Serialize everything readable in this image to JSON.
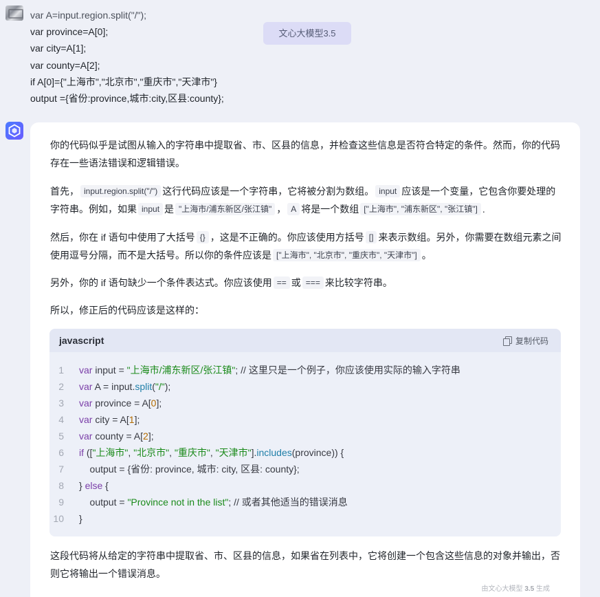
{
  "user": {
    "lines": [
      "var A=input.region.split(\"/\");",
      "var province=A[0];",
      "var city=A[1];",
      "var county=A[2];",
      "if A[0]={\"上海市\",\"北京市\",\"重庆市\",\"天津市\"}",
      "output ={省份:province,城市:city,区县:county};"
    ]
  },
  "badge": "文心大模型3.5",
  "answer": {
    "p1": "你的代码似乎是试图从输入的字符串中提取省、市、区县的信息，并检查这些信息是否符合特定的条件。然而，你的代码存在一些语法错误和逻辑错误。",
    "p2": {
      "t1": "首先，",
      "c1": "input.region.split(\"/\")",
      "t2": "这行代码应该是一个字符串，它将被分割为数组。",
      "c2": "input",
      "t3": "应该是一个变量，它包含你要处理的字符串。例如，如果",
      "c3": "input",
      "t4": "是",
      "c4": "\"上海市/浦东新区/张江镇\"",
      "t5": "，",
      "c5": "A",
      "t6": "将是一个数组",
      "c6": "[\"上海市\", \"浦东新区\", \"张江镇\"]",
      "t7": "."
    },
    "p3": {
      "t1": "然后，你在 if 语句中使用了大括号",
      "c1": "{}",
      "t2": "，这是不正确的。你应该使用方括号",
      "c2": "[]",
      "t3": "来表示数组。另外，你需要在数组元素之间使用逗号分隔，而不是大括号。所以你的条件应该是",
      "c3": "[\"上海市\", \"北京市\", \"重庆市\", \"天津市\"]",
      "t4": "。"
    },
    "p4": {
      "t1": "另外，你的 if 语句缺少一个条件表达式。你应该使用",
      "c1": "==",
      "t2": "或",
      "c2": "===",
      "t3": "来比较字符串。"
    },
    "p5": "所以，修正后的代码应该是这样的：",
    "p6": "这段代码将从给定的字符串中提取省、市、区县的信息，如果省在列表中，它将创建一个包含这些信息的对象并输出，否则它将输出一个错误消息。"
  },
  "code": {
    "language": "javascript",
    "copy_label": "复制代码",
    "lines": [
      [
        [
          "kw",
          "var"
        ],
        [
          "p",
          " input = "
        ],
        [
          "str",
          "\"上海市/浦东新区/张江镇\""
        ],
        [
          "p",
          "; // 这里只是一个例子，你应该使用实际的输入字符串"
        ]
      ],
      [
        [
          "kw",
          "var"
        ],
        [
          "p",
          " A = input."
        ],
        [
          "fn",
          "split"
        ],
        [
          "p",
          "("
        ],
        [
          "str",
          "\"/\""
        ],
        [
          "p",
          ");"
        ]
      ],
      [
        [
          "kw",
          "var"
        ],
        [
          "p",
          " province = A["
        ],
        [
          "num",
          "0"
        ],
        [
          "p",
          "];"
        ]
      ],
      [
        [
          "kw",
          "var"
        ],
        [
          "p",
          " city = A["
        ],
        [
          "num",
          "1"
        ],
        [
          "p",
          "];"
        ]
      ],
      [
        [
          "kw",
          "var"
        ],
        [
          "p",
          " county = A["
        ],
        [
          "num",
          "2"
        ],
        [
          "p",
          "];"
        ]
      ],
      [
        [
          "kw",
          "if"
        ],
        [
          "p",
          " (["
        ],
        [
          "str",
          "\"上海市\""
        ],
        [
          "p",
          ", "
        ],
        [
          "str",
          "\"北京市\""
        ],
        [
          "p",
          ", "
        ],
        [
          "str",
          "\"重庆市\""
        ],
        [
          "p",
          ", "
        ],
        [
          "str",
          "\"天津市\""
        ],
        [
          "p",
          "]."
        ],
        [
          "fn",
          "includes"
        ],
        [
          "p",
          "(province)) {"
        ]
      ],
      [
        [
          "p",
          "    output = {省份: province, 城市: city, 区县: county};"
        ]
      ],
      [
        [
          "p",
          "} "
        ],
        [
          "kw",
          "else"
        ],
        [
          "p",
          " {"
        ]
      ],
      [
        [
          "p",
          "    output = "
        ],
        [
          "str",
          "\"Province not in the list\""
        ],
        [
          "p",
          "; // 或者其他适当的错误消息"
        ]
      ],
      [
        [
          "p",
          "}"
        ]
      ]
    ]
  },
  "footer": {
    "prefix": "由文心大模型 ",
    "version": "3.5",
    "suffix": " 生成"
  }
}
